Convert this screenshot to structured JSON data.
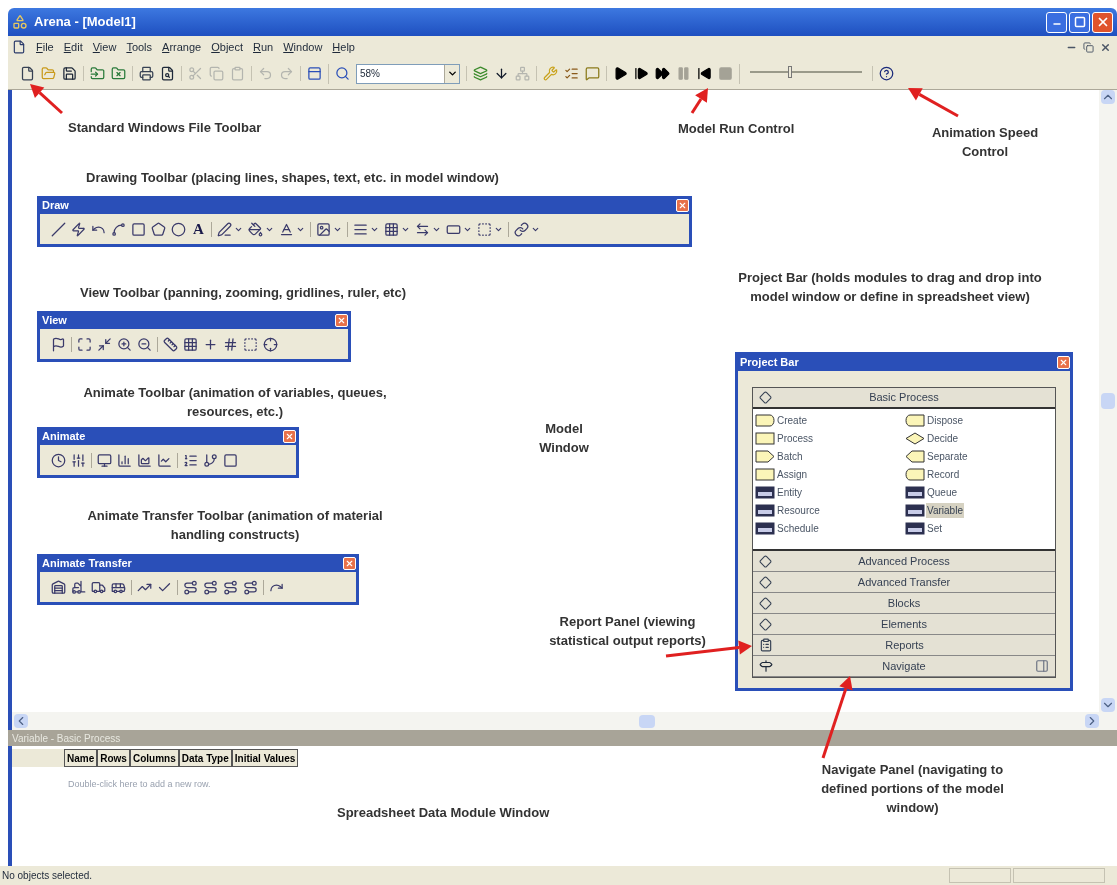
{
  "window": {
    "title": "Arena - [Model1]"
  },
  "menu": [
    {
      "label": "File"
    },
    {
      "label": "Edit"
    },
    {
      "label": "View"
    },
    {
      "label": "Tools"
    },
    {
      "label": "Arrange"
    },
    {
      "label": "Object"
    },
    {
      "label": "Run"
    },
    {
      "label": "Window"
    },
    {
      "label": "Help"
    }
  ],
  "toolbar": {
    "groups": [
      [
        {
          "kind": "new",
          "disabled": false
        },
        {
          "kind": "open",
          "disabled": false
        },
        {
          "kind": "save",
          "disabled": false
        }
      ],
      [
        {
          "kind": "attach",
          "disabled": false
        },
        {
          "kind": "detach",
          "disabled": false
        }
      ],
      [
        {
          "kind": "print",
          "disabled": false
        },
        {
          "kind": "preview",
          "disabled": false
        }
      ],
      [
        {
          "kind": "cut",
          "disabled": true
        },
        {
          "kind": "copy",
          "disabled": true
        },
        {
          "kind": "paste",
          "disabled": true
        }
      ],
      [
        {
          "kind": "undo",
          "disabled": true
        },
        {
          "kind": "redo",
          "disabled": true
        }
      ],
      [
        {
          "kind": "layout",
          "disabled": false
        }
      ],
      [
        {
          "kind": "zoom",
          "disabled": false
        },
        {
          "kind": "zoom-field",
          "disabled": false,
          "value": "58%"
        }
      ],
      [
        {
          "kind": "layers",
          "disabled": false
        },
        {
          "kind": "connect",
          "disabled": false
        },
        {
          "kind": "network",
          "disabled": true
        }
      ],
      [
        {
          "kind": "check",
          "disabled": false
        },
        {
          "kind": "list",
          "disabled": false
        },
        {
          "kind": "note",
          "disabled": false
        }
      ],
      [
        {
          "kind": "go",
          "disabled": false
        },
        {
          "kind": "step",
          "disabled": false
        },
        {
          "kind": "fast",
          "disabled": false
        },
        {
          "kind": "pause",
          "disabled": true
        },
        {
          "kind": "start-over",
          "disabled": false
        },
        {
          "kind": "end",
          "disabled": true
        }
      ],
      [
        {
          "kind": "speed",
          "level": 0.35
        }
      ],
      [
        {
          "kind": "help",
          "disabled": false
        }
      ]
    ]
  },
  "floating_toolbars": [
    {
      "title": "Draw",
      "kind": "draw",
      "text_tool": "A"
    },
    {
      "title": "View",
      "kind": "view"
    },
    {
      "title": "Animate",
      "kind": "animate"
    },
    {
      "title": "Animate Transfer",
      "kind": "transfer"
    }
  ],
  "project_bar": {
    "title": "Project Bar",
    "panels": [
      {
        "label": "Basic Process",
        "kind": "panel",
        "expanded": true,
        "modules": [
          {
            "label": "Create",
            "kind": "create",
            "selected": false
          },
          {
            "label": "Dispose",
            "kind": "dispose",
            "selected": false
          },
          {
            "label": "Process",
            "kind": "process",
            "selected": false
          },
          {
            "label": "Decide",
            "kind": "decide",
            "selected": false
          },
          {
            "label": "Batch",
            "kind": "batch",
            "selected": false
          },
          {
            "label": "Separate",
            "kind": "separate",
            "selected": false
          },
          {
            "label": "Assign",
            "kind": "process",
            "selected": false
          },
          {
            "label": "Record",
            "kind": "dispose",
            "selected": false
          },
          {
            "label": "Entity",
            "kind": "data",
            "selected": false
          },
          {
            "label": "Queue",
            "kind": "data",
            "selected": false
          },
          {
            "label": "Resource",
            "kind": "data",
            "selected": false
          },
          {
            "label": "Variable",
            "kind": "data",
            "selected": true
          },
          {
            "label": "Schedule",
            "kind": "data",
            "selected": false
          },
          {
            "label": "Set",
            "kind": "data",
            "selected": false
          }
        ]
      },
      {
        "label": "Advanced Process",
        "kind": "panel",
        "expanded": false
      },
      {
        "label": "Advanced Transfer",
        "kind": "panel",
        "expanded": false
      },
      {
        "label": "Blocks",
        "kind": "panel",
        "expanded": false
      },
      {
        "label": "Elements",
        "kind": "panel",
        "expanded": false
      },
      {
        "label": "Reports",
        "kind": "reports",
        "expanded": false
      },
      {
        "label": "Navigate",
        "kind": "navigate",
        "expanded": false
      }
    ]
  },
  "spreadsheet": {
    "title": "Variable - Basic Process",
    "columns": [
      "Name",
      "Rows",
      "Columns",
      "Data Type",
      "Initial Values"
    ],
    "hint": "Double-click here to add a new row."
  },
  "status_bar": {
    "text": "No objects selected."
  },
  "annotations": [
    {
      "text": "Standard Windows File Toolbar",
      "arrow": true
    },
    {
      "text": "Model Run Control",
      "arrow": true
    },
    {
      "text": "Animation Speed Control",
      "arrow": true
    },
    {
      "text": "Drawing Toolbar (placing lines, shapes, text, etc. in model window)",
      "arrow": false
    },
    {
      "text": "View Toolbar (panning, zooming, gridlines, ruler, etc)",
      "arrow": false
    },
    {
      "text": "Project Bar (holds modules to drag and drop into model window or define in spreadsheet view)",
      "arrow": false
    },
    {
      "text": "Animate Toolbar (animation of variables, queues, resources, etc.)",
      "arrow": false
    },
    {
      "text": "Model Window",
      "arrow": false
    },
    {
      "text": "Animate Transfer Toolbar (animation of material handling constructs)",
      "arrow": false
    },
    {
      "text": "Report Panel (viewing statistical output reports)",
      "arrow": true
    },
    {
      "text": "Navigate Panel (navigating to defined portions of the model window)",
      "arrow": true
    },
    {
      "text": "Spreadsheet Data Module Window",
      "arrow": false
    }
  ]
}
